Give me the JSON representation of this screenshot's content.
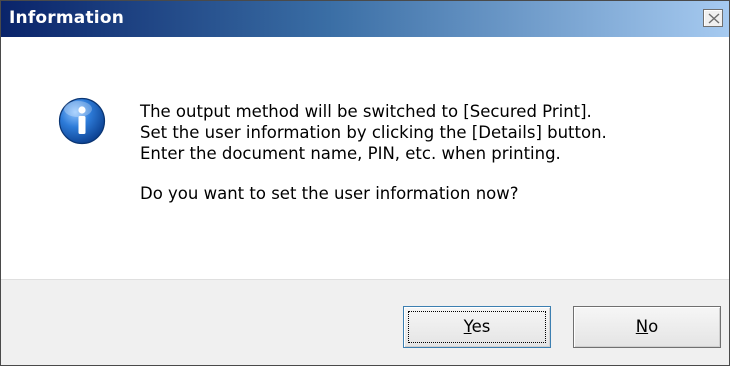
{
  "dialog": {
    "title": "Information",
    "close_symbol": "×",
    "icon": "info-icon",
    "message_lines": [
      "The output method will be switched to [Secured Print].",
      "Set the user information by clicking the [Details] button.",
      "Enter the document name, PIN, etc. when printing."
    ],
    "question": "Do you want to set the user information now?"
  },
  "buttons": {
    "yes": {
      "accel": "Y",
      "rest": "es"
    },
    "no": {
      "accel": "N",
      "rest": "o"
    }
  },
  "colors": {
    "titlebar_start": "#0a246a",
    "titlebar_end": "#a6caf0",
    "icon_blue": "#1a5fb4",
    "button_bar": "#f0f0f0"
  }
}
